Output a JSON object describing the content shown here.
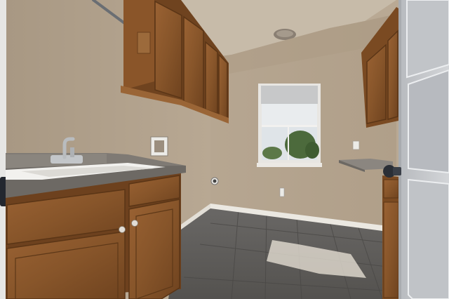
{
  "scene": {
    "room": "laundry-room",
    "palette": {
      "wall": "#b5a590",
      "wall_shadow": "#9d8d78",
      "ceiling": "#c8bcac",
      "cabinet": "#8e5a2e",
      "cabinet_dark": "#6b3f1c",
      "countertop": "#7d7873",
      "floor": "#5f5d5b",
      "baseboard": "#e8e4dc",
      "door": "#c9cbcf",
      "window_sky": "#e9ecee",
      "window_trees": "#4c6a3c"
    },
    "icons": [
      "faucet-icon",
      "door-knob-icon",
      "electrical-outlet-icon",
      "dryer-vent-icon",
      "ceiling-light-icon"
    ]
  }
}
